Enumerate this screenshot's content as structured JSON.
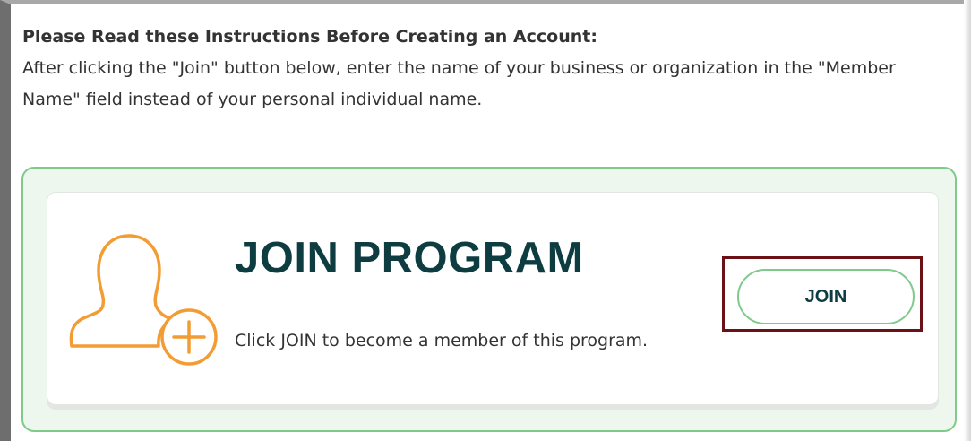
{
  "instructions": {
    "heading": "Please Read these Instructions Before Creating an Account:",
    "body": "After clicking the \"Join\" button below, enter the name of your business or organization in the \"Member Name\" field instead of your personal individual name."
  },
  "program_card": {
    "icon": "user-plus-icon",
    "title": "JOIN PROGRAM",
    "description": "Click JOIN to become a member of this program.",
    "button_label": "JOIN"
  },
  "colors": {
    "icon_orange": "#f39c33",
    "title_teal": "#0e3d41",
    "panel_border_green": "#7fc98a",
    "panel_background": "#eef7ee",
    "highlight_maroon": "#6b1116"
  }
}
